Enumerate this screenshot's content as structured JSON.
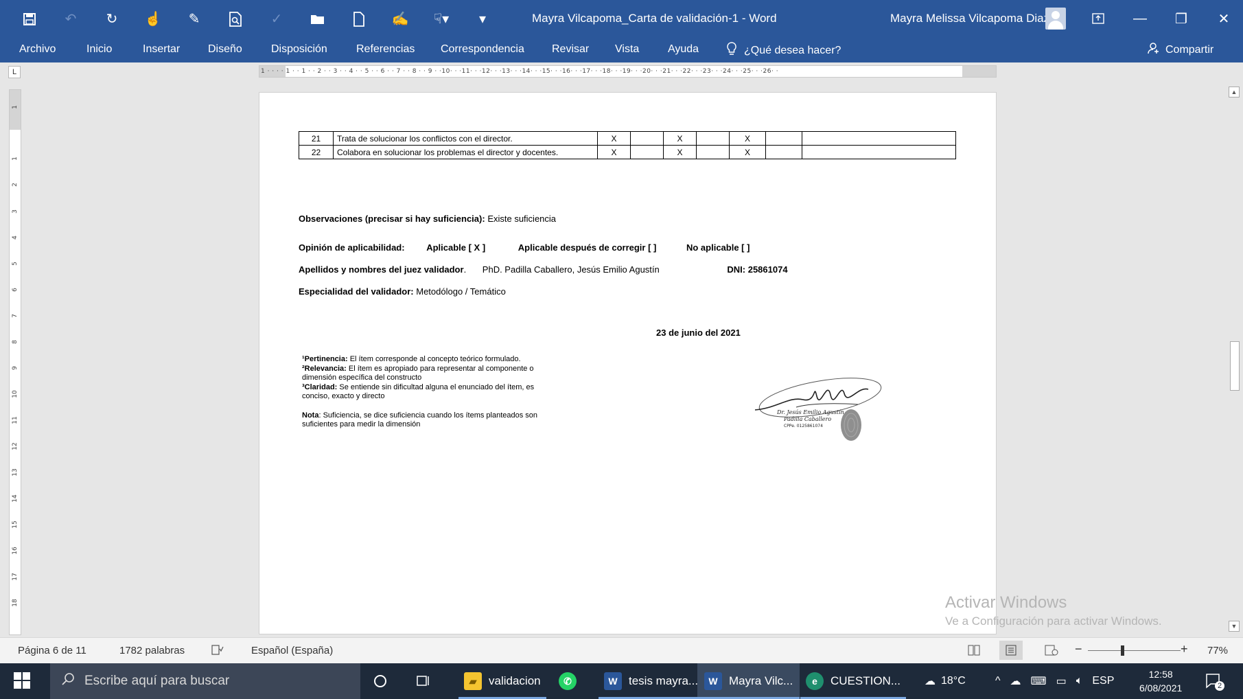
{
  "window": {
    "doc_title": "Mayra Vilcapoma_Carta de validación-1  -  Word",
    "user_name": "Mayra Melissa Vilcapoma Diaz",
    "qat_icons": [
      "save-icon",
      "undo-icon",
      "redo-icon",
      "touch-mode-icon",
      "paint-format-icon",
      "print-preview-icon",
      "spelling-icon",
      "open-icon",
      "new-document-icon",
      "edit-document-icon",
      "touch-pointer-icon",
      "customize-qat-icon"
    ]
  },
  "ribbon": {
    "tabs": [
      "Archivo",
      "Inicio",
      "Insertar",
      "Diseño",
      "Disposición",
      "Referencias",
      "Correspondencia",
      "Revisar",
      "Vista",
      "Ayuda"
    ],
    "tell_me": "¿Qué desea hacer?",
    "share": "Compartir"
  },
  "ruler": {
    "tab_selector": "L",
    "marks": "1 · · · · 1 · · 1 · · 2 · · 3 · · 4 · · 5 · · 6 · · 7 · · 8 · · 9 · ·10· · ·11· · ·12· · ·13· · ·14· · ·15· · ·16· · ·17· · ·18· · ·19· · ·20· · ·21· · ·22· · ·23· · ·24· · ·25· · ·26· ·",
    "vertical_marks": [
      "1",
      "1",
      "2",
      "3",
      "4",
      "5",
      "6",
      "7",
      "8",
      "9",
      "10",
      "11",
      "12",
      "13",
      "14",
      "15",
      "16",
      "17",
      "18"
    ]
  },
  "document": {
    "table_rows": [
      {
        "num": "21",
        "text": "Trata de solucionar los conflictos con el director.",
        "m1": "X",
        "m2": "",
        "m3": "X",
        "m4": "",
        "m5": "X",
        "m6": "",
        "m7": ""
      },
      {
        "num": "22",
        "text": "Colabora en solucionar los problemas el director y docentes.",
        "m1": "X",
        "m2": "",
        "m3": "X",
        "m4": "",
        "m5": "X",
        "m6": "",
        "m7": ""
      }
    ],
    "observaciones_label": "Observaciones (precisar si hay suficiencia):",
    "observaciones_value": "Existe suficiencia",
    "opinion_label": "Opinión de aplicabilidad:",
    "aplicable": "Aplicable [ X ]",
    "aplicable_corregir": "Aplicable después de corregir  [  ]",
    "no_aplicable": "No aplicable [ ]",
    "juez_label": "Apellidos y nombres del juez validador",
    "juez_value": "PhD. Padilla Caballero, Jesús Emilio Agustín",
    "dni": "DNI: 25861074",
    "especialidad_label": "Especialidad del validador:",
    "especialidad_value": "Metodólogo / Temático",
    "date": "23 de junio del 2021",
    "notes": {
      "pertinencia_label": "¹Pertinencia:",
      "pertinencia_text": "El ítem corresponde al concepto teórico formulado.",
      "relevancia_label": "²Relevancia:",
      "relevancia_text": "El ítem es apropiado para representar al componente o dimensión específica del constructo",
      "claridad_label": "³Claridad:",
      "claridad_text": "Se entiende sin dificultad alguna el enunciado del ítem, es conciso, exacto y directo",
      "nota_label": "Nota",
      "nota_text": ": Suficiencia, se dice suficiencia cuando los ítems planteados son suficientes para medir la dimensión"
    },
    "signature": {
      "line1": "Dr. Jesús Emilio Agustín",
      "line2": "Padilla Caballero",
      "line3": "CPPe. 0125861074"
    }
  },
  "watermark": {
    "title": "Activar Windows",
    "subtitle": "Ve a Configuración para activar Windows."
  },
  "statusbar": {
    "page": "Página 6 de 11",
    "words": "1782 palabras",
    "language": "Español (España)",
    "zoom": "77%",
    "zoom_level": 0.77
  },
  "taskbar": {
    "search_placeholder": "Escribe aquí para buscar",
    "apps": [
      {
        "label": "validacion"
      },
      {
        "label": "tesis mayra..."
      },
      {
        "label": "Mayra Vilc..."
      },
      {
        "label": "CUESTION..."
      }
    ],
    "weather": "18°C",
    "lang": "ESP",
    "time": "12:58",
    "date": "6/08/2021",
    "notifications": "2"
  },
  "colors": {
    "word_blue": "#2b579a",
    "taskbar": "#1e2a3a"
  }
}
